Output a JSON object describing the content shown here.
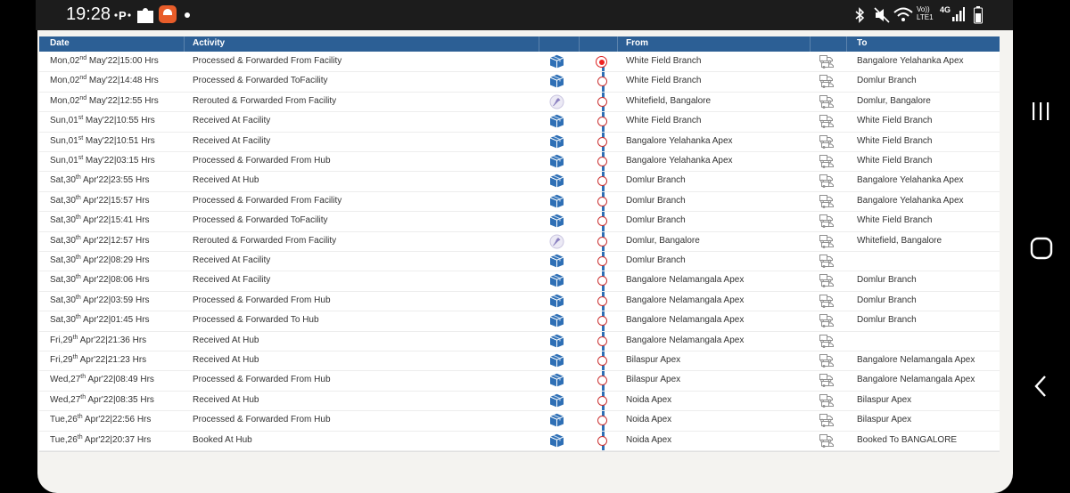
{
  "status_bar": {
    "time": "19:28",
    "left_icons": [
      "p-icon",
      "puzzle-icon",
      "app-notification-icon",
      "dot-icon"
    ],
    "right_icons": [
      "bluetooth-icon",
      "mute-icon",
      "wifi-icon",
      "volte-icon",
      "4g-signal-icon",
      "battery-icon"
    ],
    "volte_text": "Vo)) LTE1",
    "network_text": "4G"
  },
  "table": {
    "headers": {
      "date": "Date",
      "activity": "Activity",
      "from": "From",
      "to": "To"
    },
    "rows": [
      {
        "day": "Mon,02",
        "suffix": "nd",
        "rest": " May'22|15:00 Hrs",
        "activity": "Processed & Forwarded From Facility",
        "icon": "box-icon",
        "from": "White Field Branch",
        "to": "Bangalore Yelahanka Apex",
        "active": true
      },
      {
        "day": "Mon,02",
        "suffix": "nd",
        "rest": " May'22|14:48 Hrs",
        "activity": "Processed & Forwarded ToFacility",
        "icon": "box-icon",
        "from": "White Field Branch",
        "to": "Domlur Branch"
      },
      {
        "day": "Mon,02",
        "suffix": "nd",
        "rest": " May'22|12:55 Hrs",
        "activity": "Rerouted & Forwarded From Facility",
        "icon": "reroute-icon",
        "from": "Whitefield, Bangalore",
        "to": "Domlur, Bangalore"
      },
      {
        "day": "Sun,01",
        "suffix": "st",
        "rest": " May'22|10:55 Hrs",
        "activity": "Received At Facility",
        "icon": "box-icon",
        "from": "White Field Branch",
        "to": "White Field Branch"
      },
      {
        "day": "Sun,01",
        "suffix": "st",
        "rest": " May'22|10:51 Hrs",
        "activity": "Received At Facility",
        "icon": "box-icon",
        "from": "Bangalore Yelahanka Apex",
        "to": "White Field Branch"
      },
      {
        "day": "Sun,01",
        "suffix": "st",
        "rest": " May'22|03:15 Hrs",
        "activity": "Processed & Forwarded From Hub",
        "icon": "box-icon",
        "from": "Bangalore Yelahanka Apex",
        "to": "White Field Branch"
      },
      {
        "day": "Sat,30",
        "suffix": "th",
        "rest": " Apr'22|23:55 Hrs",
        "activity": "Received At Hub",
        "icon": "box-icon",
        "from": "Domlur Branch",
        "to": "Bangalore Yelahanka Apex"
      },
      {
        "day": "Sat,30",
        "suffix": "th",
        "rest": " Apr'22|15:57 Hrs",
        "activity": "Processed & Forwarded From Facility",
        "icon": "box-icon",
        "from": "Domlur Branch",
        "to": "Bangalore Yelahanka Apex"
      },
      {
        "day": "Sat,30",
        "suffix": "th",
        "rest": " Apr'22|15:41 Hrs",
        "activity": "Processed & Forwarded ToFacility",
        "icon": "box-icon",
        "from": "Domlur Branch",
        "to": "White Field Branch"
      },
      {
        "day": "Sat,30",
        "suffix": "th",
        "rest": " Apr'22|12:57 Hrs",
        "activity": "Rerouted & Forwarded From Facility",
        "icon": "reroute-icon",
        "from": "Domlur, Bangalore",
        "to": "Whitefield, Bangalore"
      },
      {
        "day": "Sat,30",
        "suffix": "th",
        "rest": " Apr'22|08:29 Hrs",
        "activity": "Received At Facility",
        "icon": "box-icon",
        "from": "Domlur Branch",
        "to": ""
      },
      {
        "day": "Sat,30",
        "suffix": "th",
        "rest": " Apr'22|08:06 Hrs",
        "activity": "Received At Facility",
        "icon": "box-icon",
        "from": "Bangalore Nelamangala Apex",
        "to": "Domlur Branch"
      },
      {
        "day": "Sat,30",
        "suffix": "th",
        "rest": " Apr'22|03:59 Hrs",
        "activity": "Processed & Forwarded From Hub",
        "icon": "box-icon",
        "from": "Bangalore Nelamangala Apex",
        "to": "Domlur Branch"
      },
      {
        "day": "Sat,30",
        "suffix": "th",
        "rest": " Apr'22|01:45 Hrs",
        "activity": "Processed & Forwarded To Hub",
        "icon": "box-icon",
        "from": "Bangalore Nelamangala Apex",
        "to": "Domlur Branch"
      },
      {
        "day": "Fri,29",
        "suffix": "th",
        "rest": " Apr'22|21:36 Hrs",
        "activity": "Received At Hub",
        "icon": "box-icon",
        "from": "Bangalore Nelamangala Apex",
        "to": ""
      },
      {
        "day": "Fri,29",
        "suffix": "th",
        "rest": " Apr'22|21:23 Hrs",
        "activity": "Received At Hub",
        "icon": "box-icon",
        "from": "Bilaspur Apex",
        "to": "Bangalore Nelamangala Apex"
      },
      {
        "day": "Wed,27",
        "suffix": "th",
        "rest": " Apr'22|08:49 Hrs",
        "activity": "Processed & Forwarded From Hub",
        "icon": "box-icon",
        "from": "Bilaspur Apex",
        "to": "Bangalore Nelamangala Apex"
      },
      {
        "day": "Wed,27",
        "suffix": "th",
        "rest": " Apr'22|08:35 Hrs",
        "activity": "Received At Hub",
        "icon": "box-icon",
        "from": "Noida Apex",
        "to": "Bilaspur Apex"
      },
      {
        "day": "Tue,26",
        "suffix": "th",
        "rest": " Apr'22|22:56 Hrs",
        "activity": "Processed & Forwarded From Hub",
        "icon": "box-icon",
        "from": "Noida Apex",
        "to": "Bilaspur Apex"
      },
      {
        "day": "Tue,26",
        "suffix": "th",
        "rest": " Apr'22|20:37 Hrs",
        "activity": "Booked At Hub",
        "icon": "box-icon",
        "from": "Noida Apex",
        "to": "Booked To BANGALORE"
      }
    ]
  },
  "nav_bar": {
    "buttons": [
      "recents-button",
      "home-button",
      "back-button"
    ]
  },
  "colors": {
    "header_bg": "#2c5f95",
    "timeline": "#2e6fb5",
    "active_dot": "#e22222",
    "box_icon": "#2e6fb5"
  }
}
